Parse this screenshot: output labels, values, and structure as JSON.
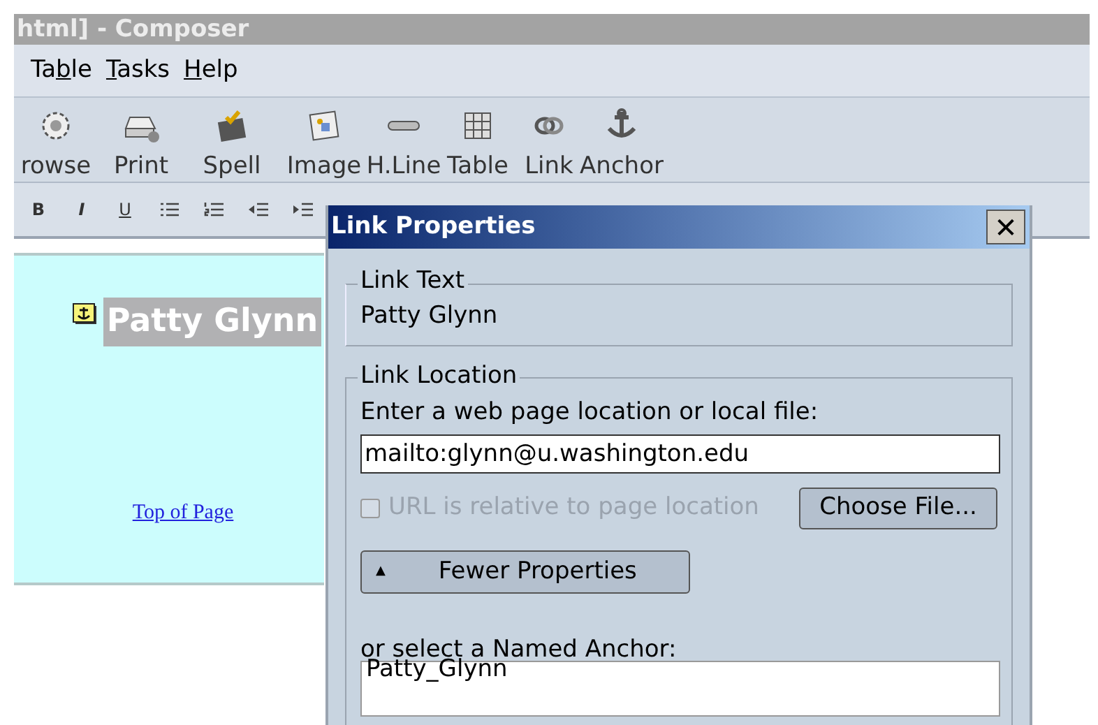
{
  "window": {
    "title": "html] - Composer"
  },
  "menu": [
    {
      "before": "Ta",
      "mnemonic": "b",
      "after": "le"
    },
    {
      "mnemonic": "T",
      "after": "asks"
    },
    {
      "mnemonic": "H",
      "after": "elp"
    }
  ],
  "toolbar": [
    {
      "kind": "browse",
      "label": "rowse"
    },
    {
      "kind": "print",
      "label": "Print"
    },
    {
      "kind": "spell",
      "label": "Spell"
    },
    {
      "kind": "image",
      "label": "Image"
    },
    {
      "kind": "hline",
      "label": "H.Line"
    },
    {
      "kind": "table",
      "label": "Table"
    },
    {
      "kind": "link",
      "label": "Link"
    },
    {
      "kind": "anchor",
      "label": "Anchor"
    }
  ],
  "format_toolbar": [
    {
      "kind": "text",
      "label": "B"
    },
    {
      "kind": "text",
      "label": "I"
    },
    {
      "kind": "text",
      "label": "U"
    },
    {
      "kind": "bullets"
    },
    {
      "kind": "numbers"
    },
    {
      "kind": "outdent"
    },
    {
      "kind": "indent"
    }
  ],
  "editor": {
    "heading": "Patty Glynn",
    "heading_selected": true,
    "link": "Top of Page"
  },
  "dialog": {
    "title": "Link Properties",
    "close": "✕",
    "link_text_legend": "Link Text",
    "link_text": "Patty Glynn",
    "location_legend": "Link Location",
    "location_prompt": "Enter a web page location or local file:",
    "location_value": "mailto:glynn@u.washington.edu",
    "relative": {
      "label": "URL is relative to page location",
      "checked": false,
      "disabled": true
    },
    "choose_file": "Choose File...",
    "fewer": {
      "arrow": "▲",
      "label": "Fewer Properties"
    },
    "anchor_prompt": "or select a Named Anchor:",
    "anchors": [
      {
        "label": "Patty_Glynn",
        "selected": false
      }
    ]
  }
}
